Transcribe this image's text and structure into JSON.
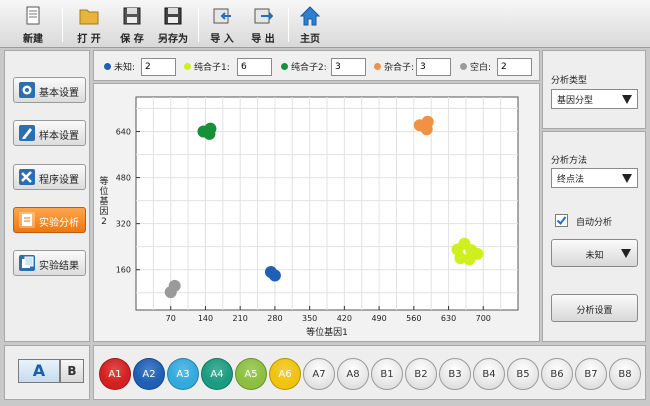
{
  "toolbar": {
    "new_label": "新建",
    "open_label": "打 开",
    "save_label": "保 存",
    "saveas_label": "另存为",
    "import_label": "导 入",
    "export_label": "导 出",
    "home_label": "主页"
  },
  "nav": {
    "basic": "基本设置",
    "sample": "样本设置",
    "program": "程序设置",
    "analysis": "实验分析",
    "result": "实验结果"
  },
  "plate_toggle": {
    "a": "A",
    "b": "B"
  },
  "legend": [
    {
      "label": "未知:",
      "count": "2",
      "color": "#1f5fb5"
    },
    {
      "label": "纯合子1:",
      "count": "6",
      "color": "#cfef1f"
    },
    {
      "label": "纯合子2:",
      "count": "3",
      "color": "#15913a"
    },
    {
      "label": "杂合子:",
      "count": "3",
      "color": "#f29044"
    },
    {
      "label": "空白:",
      "count": "2",
      "color": "#9a9a9a"
    }
  ],
  "chart_data": {
    "type": "scatter",
    "xlabel": "等位基因1",
    "ylabel": "等位基因2",
    "xlim": [
      0,
      770
    ],
    "ylim": [
      20,
      760
    ],
    "xticks": [
      70,
      140,
      210,
      280,
      350,
      420,
      490,
      560,
      630,
      700
    ],
    "yticks": [
      160,
      320,
      480,
      640
    ],
    "grid": true,
    "series": [
      {
        "name": "未知",
        "color": "#1f5fb5",
        "points": [
          [
            272,
            152
          ],
          [
            280,
            140
          ]
        ]
      },
      {
        "name": "纯合子1",
        "color": "#cfef1f",
        "points": [
          [
            648,
            230
          ],
          [
            662,
            250
          ],
          [
            676,
            228
          ],
          [
            688,
            215
          ],
          [
            654,
            200
          ],
          [
            672,
            196
          ]
        ]
      },
      {
        "name": "纯合子2",
        "color": "#15913a",
        "points": [
          [
            136,
            640
          ],
          [
            148,
            632
          ],
          [
            150,
            650
          ]
        ]
      },
      {
        "name": "杂合子",
        "color": "#f29044",
        "points": [
          [
            572,
            662
          ],
          [
            586,
            648
          ],
          [
            588,
            674
          ]
        ]
      },
      {
        "name": "空白",
        "color": "#9a9a9a",
        "points": [
          [
            70,
            82
          ],
          [
            78,
            104
          ]
        ]
      }
    ]
  },
  "right": {
    "type_title": "分析类型",
    "type_value": "基因分型",
    "method_title": "分析方法",
    "method_value": "终点法",
    "auto_label": "自动分析",
    "auto_checked": true,
    "unknown_value": "未知",
    "settings_label": "分析设置"
  },
  "wells": [
    {
      "label": "A1",
      "color": "#d32020",
      "active": true
    },
    {
      "label": "A2",
      "color": "#1f5fb5",
      "active": true
    },
    {
      "label": "A3",
      "color": "#33a9dd",
      "active": true
    },
    {
      "label": "A4",
      "color": "#1b9b80",
      "active": true
    },
    {
      "label": "A5",
      "color": "#8cbf3f",
      "active": true
    },
    {
      "label": "A6",
      "color": "#f0c30e",
      "active": true
    },
    {
      "label": "A7",
      "active": false
    },
    {
      "label": "A8",
      "active": false
    },
    {
      "label": "B1",
      "active": false
    },
    {
      "label": "B2",
      "active": false
    },
    {
      "label": "B3",
      "active": false
    },
    {
      "label": "B4",
      "active": false
    },
    {
      "label": "B5",
      "active": false
    },
    {
      "label": "B6",
      "active": false
    },
    {
      "label": "B7",
      "active": false
    },
    {
      "label": "B8",
      "active": false
    }
  ]
}
